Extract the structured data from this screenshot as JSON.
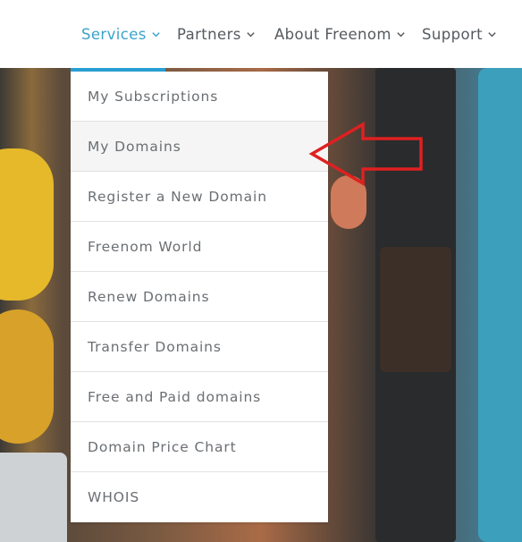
{
  "nav": {
    "services": "Services",
    "partners": "Partners",
    "about": "About Freenom",
    "support": "Support"
  },
  "dropdown": {
    "items": [
      "My Subscriptions",
      "My Domains",
      "Register a New Domain",
      "Freenom World",
      "Renew Domains",
      "Transfer Domains",
      "Free and Paid domains",
      "Domain Price Chart",
      "WHOIS"
    ],
    "highlighted": "My Domains"
  },
  "colors": {
    "active_nav": "#3aa3c9",
    "nav_text": "#555a5f",
    "menu_text": "#6b6f73",
    "arrow": "#e02020",
    "active_underline": "#29a0d4"
  },
  "icons": {
    "nav_caret": "chevron-down-icon",
    "annotation": "left-arrow-icon"
  }
}
